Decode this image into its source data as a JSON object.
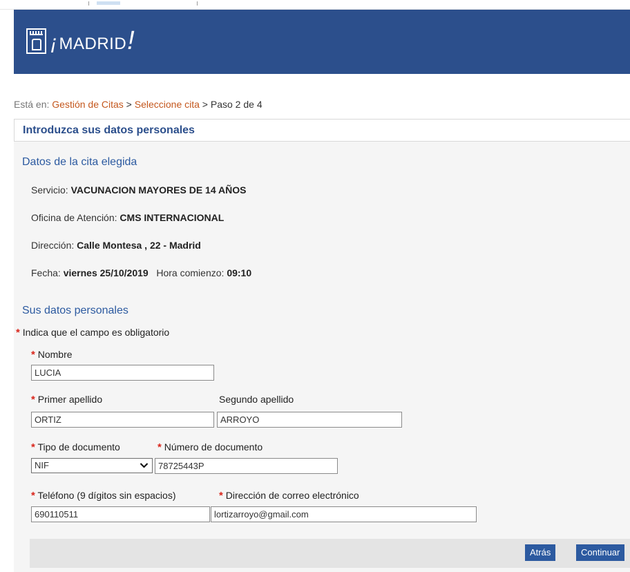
{
  "header": {
    "logo_text_main": "MADRID",
    "logo_text_open": "¡",
    "logo_text_close": "!",
    "background_color": "#2c4f8c"
  },
  "breadcrumb": {
    "prefix": "Está en:",
    "items": [
      "Gestión de Citas",
      "Seleccione cita"
    ],
    "separator": ">",
    "current": "Paso 2 de 4"
  },
  "page": {
    "title": "Introduzca sus datos personales"
  },
  "appointment": {
    "section_title": "Datos de la cita elegida",
    "service_label": "Servicio:",
    "service_value": "VACUNACION MAYORES DE 14 AÑOS",
    "office_label": "Oficina de Atención:",
    "office_value": "CMS INTERNACIONAL",
    "address_label": "Dirección:",
    "address_value": "Calle Montesa , 22 - Madrid",
    "date_label": "Fecha:",
    "date_value": "viernes 25/10/2019",
    "time_label": "Hora comienzo:",
    "time_value": "09:10"
  },
  "personal": {
    "section_title": "Sus datos personales",
    "required_note": "Indica que el campo es obligatorio",
    "required_mark": "*",
    "fields": {
      "nombre": {
        "label": "Nombre",
        "value": "LUCIA",
        "required": true
      },
      "primer_apellido": {
        "label": "Primer apellido",
        "value": "ORTIZ",
        "required": true
      },
      "segundo_apellido": {
        "label": "Segundo apellido",
        "value": "ARROYO",
        "required": false
      },
      "tipo_documento": {
        "label": "Tipo de documento",
        "value": "NIF",
        "required": true
      },
      "numero_documento": {
        "label": "Número de documento",
        "value": "78725443P",
        "required": true
      },
      "telefono": {
        "label": "Teléfono (9 dígitos sin espacios)",
        "value": "690110511",
        "required": true
      },
      "email": {
        "label": "Dirección de correo electrónico",
        "value": "lortizarroyo@gmail.com",
        "required": true
      }
    }
  },
  "actions": {
    "back_label": "Atrás",
    "continue_label": "Continuar"
  },
  "colors": {
    "link_orange": "#c4571d",
    "title_blue": "#2c4f8c",
    "required_red": "#d9261c",
    "button_blue": "#2c5aa0"
  }
}
